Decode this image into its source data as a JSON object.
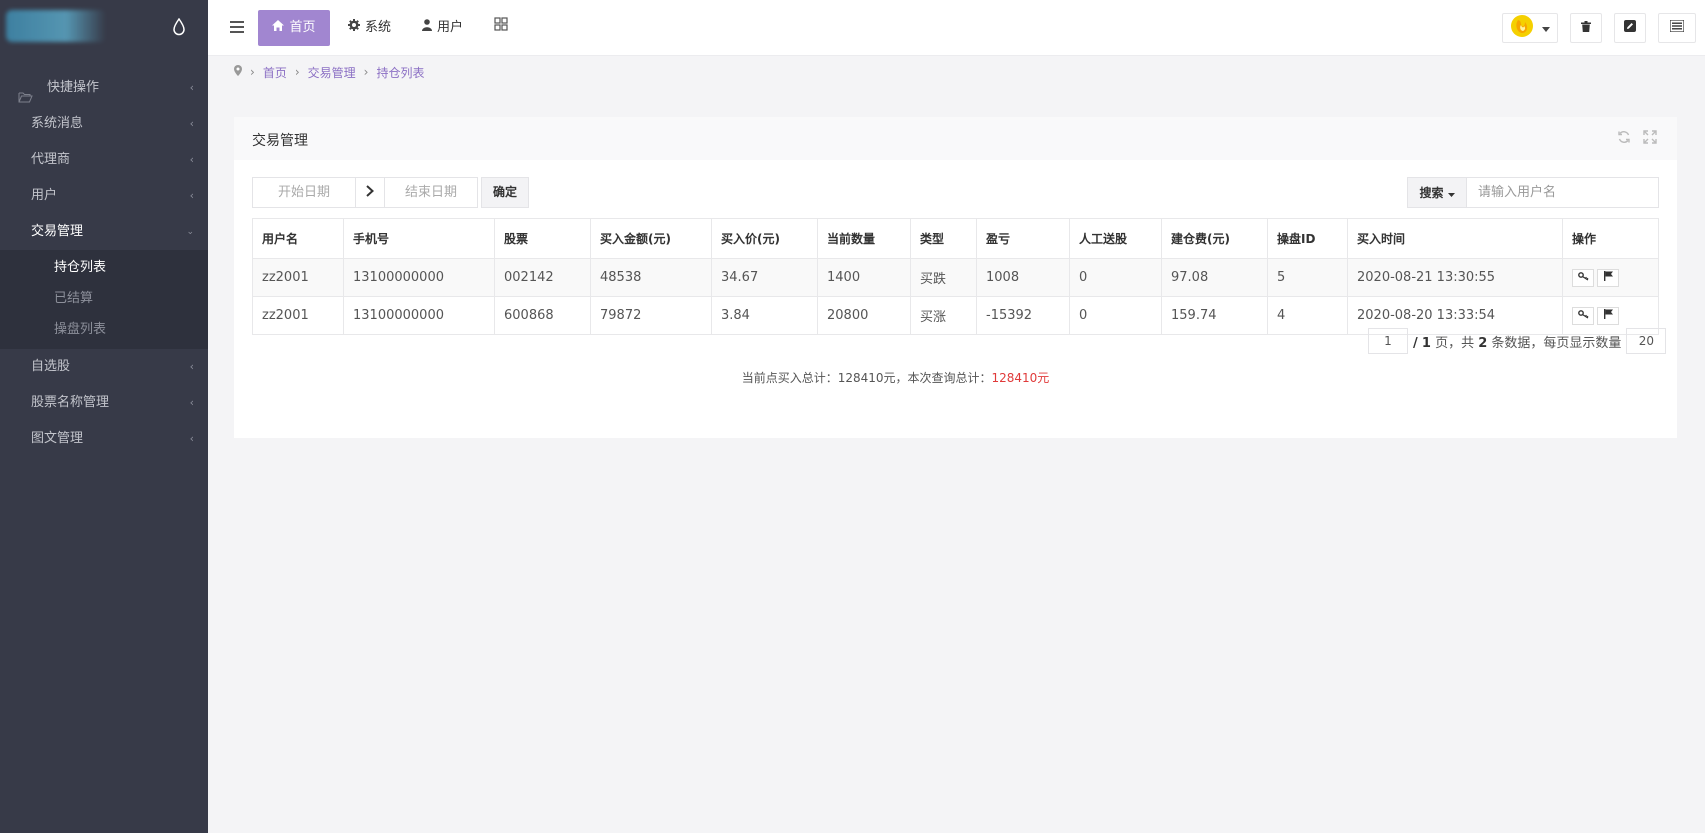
{
  "sidebar": {
    "items": [
      {
        "label": "快捷操作"
      },
      {
        "label": "系统消息"
      },
      {
        "label": "代理商"
      },
      {
        "label": "用户"
      },
      {
        "label": "交易管理"
      },
      {
        "label": "自选股"
      },
      {
        "label": "股票名称管理"
      },
      {
        "label": "图文管理"
      }
    ],
    "submenu": [
      {
        "label": "持仓列表"
      },
      {
        "label": "已结算"
      },
      {
        "label": "操盘列表"
      }
    ]
  },
  "topbar": {
    "home_label": "首页",
    "system_label": "系统",
    "user_label": "用户"
  },
  "breadcrumb": {
    "home": "首页",
    "section": "交易管理",
    "page": "持仓列表"
  },
  "panel": {
    "title": "交易管理"
  },
  "filters": {
    "start_placeholder": "开始日期",
    "end_placeholder": "结束日期",
    "confirm_label": "确定",
    "search_label": "搜索",
    "search_placeholder": "请输入用户名"
  },
  "table": {
    "headers": [
      "用户名",
      "手机号",
      "股票",
      "买入金额(元)",
      "买入价(元)",
      "当前数量",
      "类型",
      "盈亏",
      "人工送股",
      "建仓费(元)",
      "操盘ID",
      "买入时间",
      "操作"
    ],
    "rows": [
      [
        "zz2001",
        "13100000000",
        "002142",
        "48538",
        "34.67",
        "1400",
        "买跌",
        "1008",
        "0",
        "97.08",
        "5",
        "2020-08-21 13:30:55"
      ],
      [
        "zz2001",
        "13100000000",
        "600868",
        "79872",
        "3.84",
        "20800",
        "买涨",
        "-15392",
        "0",
        "159.74",
        "4",
        "2020-08-20 13:33:54"
      ]
    ]
  },
  "pager": {
    "current_page": "1",
    "slash": "/",
    "total_pages": "1",
    "page_word": "页，共",
    "total_count": "2",
    "count_word": "条数据，每页显示数量",
    "page_size": "20"
  },
  "summary": {
    "prefix": "当前点买入总计：128410元，本次查询总计：",
    "total": "128410元"
  },
  "colors": {
    "sidebar_bg": "#373a48",
    "accent": "#a186d0",
    "highlight_red": "#e03a3a"
  }
}
